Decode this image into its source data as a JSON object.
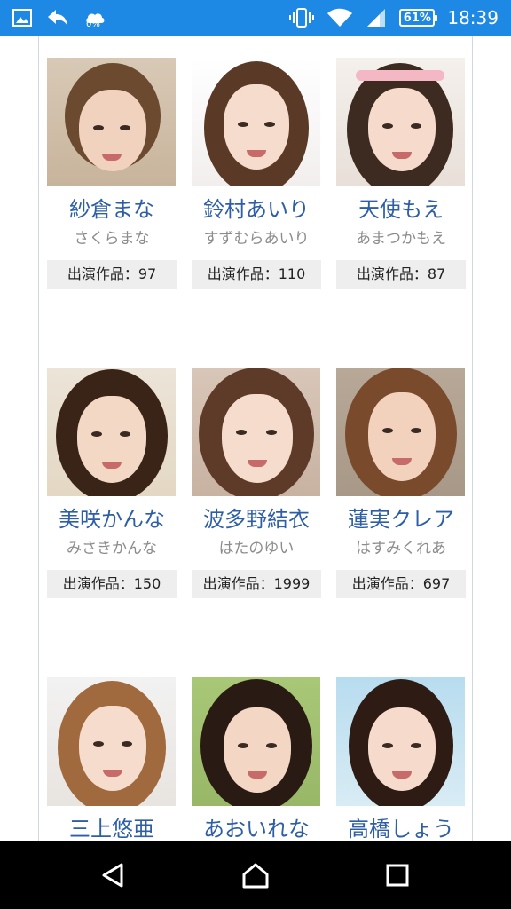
{
  "status_bar": {
    "data_saver_percent": "0%",
    "battery_percent": "61%",
    "time": "18:39",
    "icons": [
      "gallery-icon",
      "reply-arrow-icon",
      "cloud-sync-icon",
      "vibrate-icon",
      "wifi-icon",
      "signal-icon",
      "battery-icon"
    ]
  },
  "actresses": [
    {
      "name": "紗倉まな",
      "kana": "さくらまな",
      "works": "出演作品：97"
    },
    {
      "name": "鈴村あいり",
      "kana": "すずむらあいり",
      "works": "出演作品：110"
    },
    {
      "name": "天使もえ",
      "kana": "あまつかもえ",
      "works": "出演作品：87"
    },
    {
      "name": "美咲かんな",
      "kana": "みさきかんな",
      "works": "出演作品：150"
    },
    {
      "name": "波多野結衣",
      "kana": "はたのゆい",
      "works": "出演作品：1999"
    },
    {
      "name": "蓮実クレア",
      "kana": "はすみくれあ",
      "works": "出演作品：697"
    },
    {
      "name": "三上悠亜",
      "kana": "",
      "works": ""
    },
    {
      "name": "あおいれな",
      "kana": "",
      "works": ""
    },
    {
      "name": "高橋しょう",
      "kana": "",
      "works": ""
    }
  ],
  "nav_bar": {
    "icons": [
      "back-icon",
      "home-icon",
      "recents-icon"
    ]
  },
  "colors": {
    "status_bar": "#1e88e5",
    "name_text": "#2e5fa6",
    "kana_text": "#8c8c8c",
    "works_bg": "#eeeeee"
  }
}
